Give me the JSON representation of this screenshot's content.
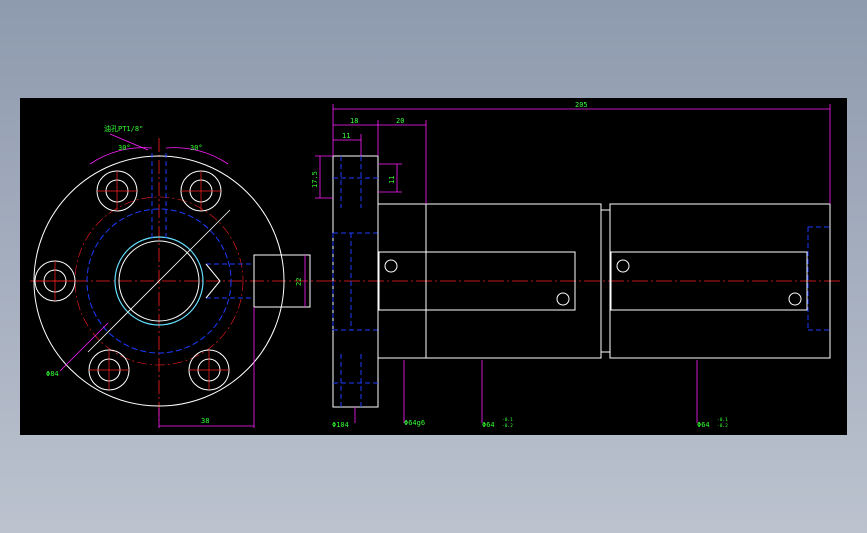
{
  "drawing": {
    "background": "#000000",
    "colors": {
      "outline": "#ffffff",
      "hidden": "#1a3cff",
      "center": "#ff2020",
      "dimension_line": "#ff20ff",
      "dimension_text": "#33ff33",
      "bore": "#66e0ff"
    },
    "front_view": {
      "callout_oil_hole": "油孔PT1/8\"",
      "angle_left": "30°",
      "angle_right": "30°",
      "dim_bolt_circle": "Φ84",
      "dim_offset": "38",
      "dim_boss": "22"
    },
    "side_view": {
      "dim_total_length": "205",
      "dim_flange_18": "18",
      "dim_20": "20",
      "dim_11_top": "11",
      "dim_17_5": "17.5",
      "dim_11_side": "11",
      "dim_flange_dia": "Φ104",
      "dim_body_dia": "Φ64g6",
      "dim_dia_64_a": "Φ64",
      "dim_tol_a_upper": "-0.1",
      "dim_tol_a_lower": "-0.2",
      "dim_dia_64_b": "Φ64",
      "dim_tol_b_upper": "-0.1",
      "dim_tol_b_lower": "-0.2"
    }
  }
}
